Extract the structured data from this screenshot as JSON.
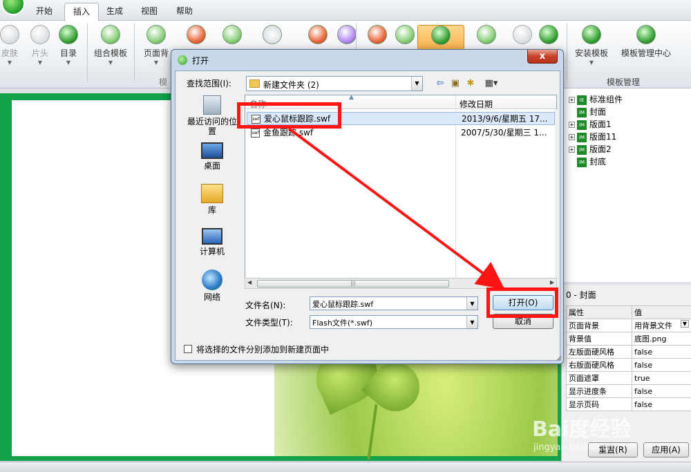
{
  "tabs": [
    "开始",
    "插入",
    "生成",
    "视图",
    "帮助"
  ],
  "ribbon": {
    "buttons": [
      "皮肤",
      "片头",
      "目录",
      "组合模板",
      "页面背"
    ],
    "right_buttons": [
      "安装模板",
      "模板管理中心"
    ],
    "group_label": "模板管理",
    "partial_group_label": "模"
  },
  "tree": {
    "items": [
      "标准组件",
      "封面",
      "版面1",
      "版面11",
      "版面2",
      "封底"
    ]
  },
  "properties": {
    "title": "0 - 封面",
    "header": [
      "属性",
      "值"
    ],
    "rows": [
      {
        "name": "页面背景",
        "value": "用背景文件"
      },
      {
        "name": "背景值",
        "value": "底图.png"
      },
      {
        "name": "左版面硬风格",
        "value": "false"
      },
      {
        "name": "右版面硬风格",
        "value": "false"
      },
      {
        "name": "页面遮罩",
        "value": "true"
      },
      {
        "name": "显示进度条",
        "value": "false"
      },
      {
        "name": "显示页码",
        "value": "false"
      }
    ],
    "reset_button": "重置(R)",
    "apply_button": "应用(A)"
  },
  "dialog": {
    "title": "打开",
    "close": "x",
    "lookin_label": "查找范围(I):",
    "lookin_value": "新建文件夹 (2)",
    "places": [
      "最近访问的位置",
      "桌面",
      "库",
      "计算机",
      "网络"
    ],
    "columns": [
      "名称",
      "修改日期"
    ],
    "files": [
      {
        "name": "爱心鼠标跟踪.swf",
        "date": "2013/9/6/星期五 17...",
        "selected": true
      },
      {
        "name": "金鱼跟踪.swf",
        "date": "2007/5/30/星期三 1...",
        "selected": false
      }
    ],
    "filename_label": "文件名(N):",
    "filename_value": "爱心鼠标跟踪.swf",
    "filetype_label": "文件类型(T):",
    "filetype_value": "Flash文件(*.swf)",
    "open_button": "打开(O)",
    "cancel_button": "取消",
    "checkbox_label": "将选择的文件分别添加到新建页面中"
  },
  "watermark": {
    "text": "Bai度经验",
    "url": "jingyan.baidu.com"
  },
  "colors": {
    "canvas_green": "#12a24a",
    "annotation_red": "#ff1414",
    "selection_blue": "#dbe9fa"
  }
}
